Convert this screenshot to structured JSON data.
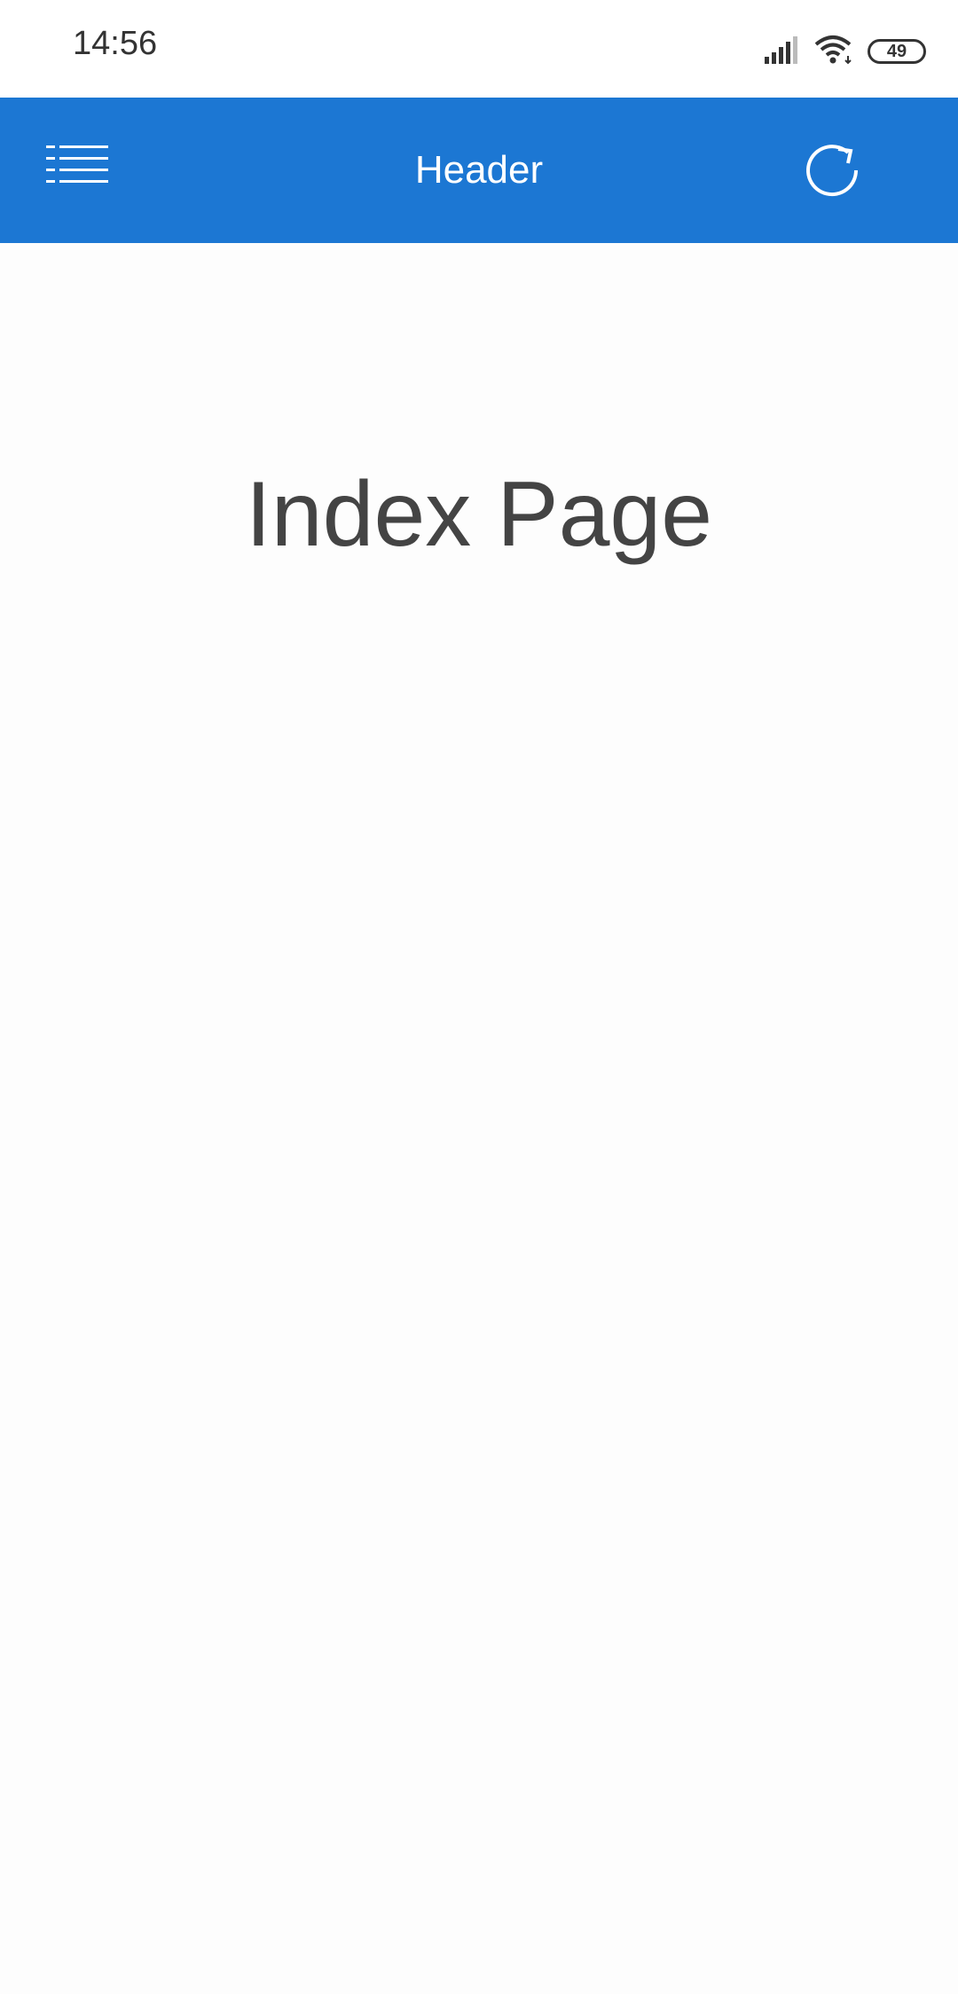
{
  "status_bar": {
    "time": "14:56",
    "battery_level": "49",
    "icons": [
      "signal-icon",
      "wifi-icon",
      "battery-icon"
    ]
  },
  "header": {
    "title": "Header",
    "left_icon": "menu-list-icon",
    "right_icon": "refresh-icon",
    "background_color": "#1c77d3"
  },
  "main": {
    "title": "Index Page"
  }
}
